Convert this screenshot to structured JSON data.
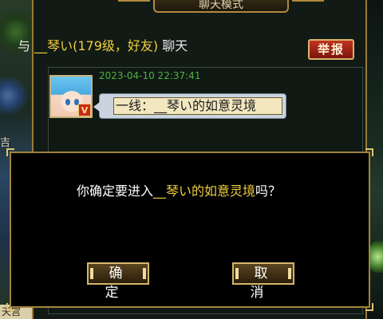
{
  "window": {
    "title": "聊天模式"
  },
  "chat": {
    "prefix": "与 ",
    "peer": "__琴い(179级，好友)",
    "suffix": " 聊天",
    "report_label": "举报"
  },
  "message": {
    "timestamp": "2023-04-10 22:37:41",
    "text": "一线：__琴い的如意灵境",
    "avatar_badge": "V"
  },
  "dialog": {
    "text_before": "你确定要进入",
    "highlight": "__琴い的如意灵境",
    "text_after": "吗？",
    "confirm_label": "确定",
    "cancel_label": "取消"
  },
  "scenery": {
    "side_text": "吉",
    "bottom_text": "天宫"
  },
  "colors": {
    "highlight": "#f0cf3b",
    "timestamp": "#4db33a",
    "frame_gold": "#a2843c",
    "report_red": "#c23422"
  }
}
